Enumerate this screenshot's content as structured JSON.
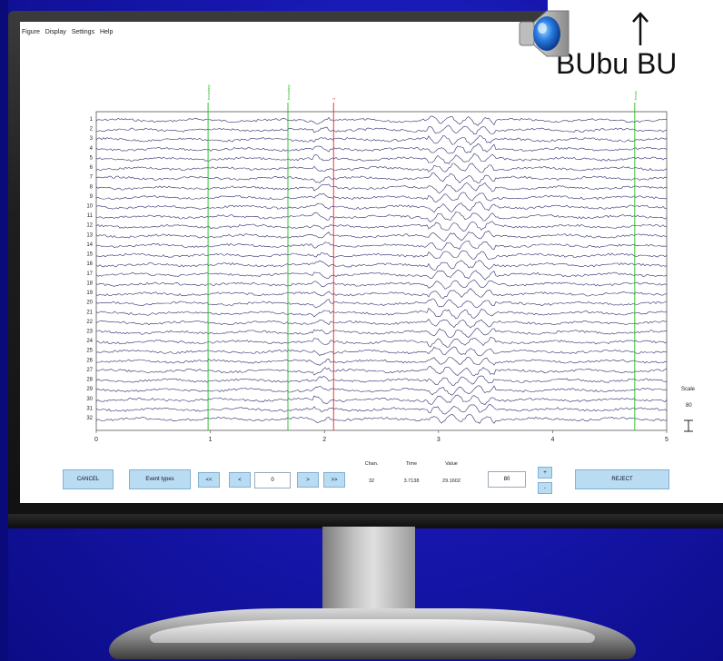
{
  "menu": [
    "Figure",
    "Display",
    "Settings",
    "Help"
  ],
  "window_close": "x",
  "channel_labels": [
    "1",
    "2",
    "3",
    "4",
    "5",
    "6",
    "7",
    "8",
    "9",
    "10",
    "11",
    "12",
    "13",
    "14",
    "15",
    "16",
    "17",
    "18",
    "19",
    "20",
    "21",
    "22",
    "23",
    "24",
    "25",
    "26",
    "27",
    "28",
    "29",
    "30",
    "31",
    "32"
  ],
  "x_ticks": [
    "0",
    "1",
    "2",
    "3",
    "4",
    "5"
  ],
  "events": [
    {
      "time": 0.98,
      "label": "boundary",
      "color": "#22bb22"
    },
    {
      "time": 1.68,
      "label": "boundary",
      "color": "#22bb22"
    },
    {
      "time": 2.08,
      "label": "1",
      "color": "#ee2222"
    },
    {
      "time": 4.72,
      "label": "boundary",
      "color": "#22bb22"
    }
  ],
  "scale": {
    "label": "Scale",
    "value": "80"
  },
  "controls": {
    "cancel": "CANCEL",
    "event_types": "Event types",
    "first": "<<",
    "prev": "<",
    "position": "0",
    "next": ">",
    "last": ">>",
    "scale_input": "80",
    "scale_up": "+",
    "scale_down": "-",
    "reject": "REJECT"
  },
  "readout": {
    "chan_header": "Chan.",
    "time_header": "Time",
    "value_header": "Value",
    "chan": "32",
    "time": "3.7138",
    "value": "29.1602"
  },
  "overlay": {
    "callout_text": "BUbu BU",
    "arrow": "↑"
  },
  "colors": {
    "trace": "#2c2c6e",
    "button": "#b9dcf3",
    "background": "#1a1ab8"
  }
}
